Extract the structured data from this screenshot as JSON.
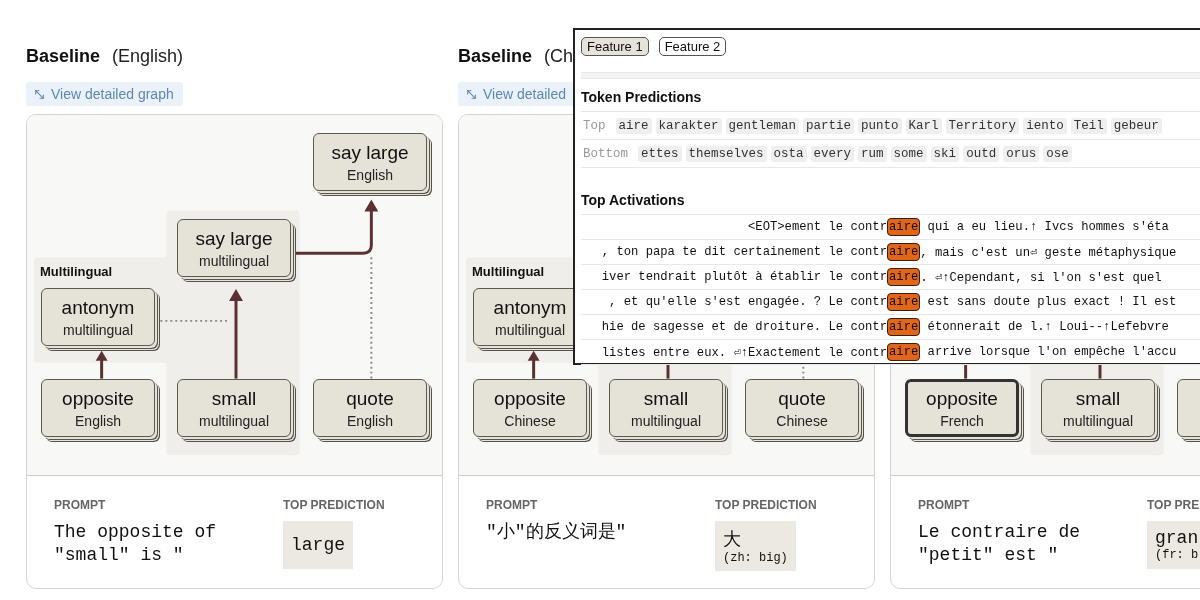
{
  "panels": [
    {
      "title": "Baseline",
      "subtitle": "(English)",
      "graph_button": "View detailed graph",
      "group_label": "Multilingual",
      "nodes": {
        "say_output": {
          "title": "say large",
          "subtitle": "English",
          "selected": false
        },
        "say_multilingual": {
          "title": "say large",
          "subtitle": "multilingual",
          "selected": false
        },
        "antonym": {
          "title": "antonym",
          "subtitle": "multilingual",
          "selected": false
        },
        "opposite": {
          "title": "opposite",
          "subtitle": "English",
          "selected": false
        },
        "small": {
          "title": "small",
          "subtitle": "multilingual",
          "selected": false
        },
        "quote": {
          "title": "quote",
          "subtitle": "English",
          "selected": false
        }
      },
      "prompt_label": "PROMPT",
      "prompt": "The opposite of \"small\" is \"",
      "prediction_label": "TOP PREDICTION",
      "prediction": "large"
    },
    {
      "title": "Baseline",
      "subtitle": "(Ch",
      "graph_button": "View detailed",
      "group_label": "Multilingual",
      "nodes": {
        "antonym": {
          "title": "antonym",
          "subtitle": "multilingual",
          "selected": false
        },
        "opposite": {
          "title": "opposite",
          "subtitle": "Chinese",
          "selected": false
        },
        "small": {
          "title": "small",
          "subtitle": "multilingual",
          "selected": false
        },
        "quote": {
          "title": "quote",
          "subtitle": "Chinese",
          "selected": false
        }
      },
      "prompt_label": "PROMPT",
      "prompt": "\"小\"的反义词是\"",
      "prediction_label": "TOP PREDICTION",
      "prediction": "大",
      "prediction_gloss": "(zh: big)"
    },
    {
      "nodes": {
        "opposite": {
          "title": "opposite",
          "subtitle": "French",
          "selected": true
        },
        "small": {
          "title": "small",
          "subtitle": "multilingual",
          "selected": false
        },
        "quote": {
          "selected": false
        }
      },
      "prompt_label": "PROMPT",
      "prompt": "Le contraire de \"petit\" est \"",
      "prediction_label": "TOP PRE",
      "prediction": "gran",
      "prediction_gloss": "(fr: b"
    }
  ],
  "popup": {
    "tabs": [
      {
        "label": "Feature 1",
        "selected": true
      },
      {
        "label": "Feature 2",
        "selected": false
      }
    ],
    "token_predictions": {
      "heading": "Token Predictions",
      "rows": [
        {
          "label": "Top",
          "tokens": [
            "aire",
            "karakter",
            "gentleman",
            "partie",
            "punto",
            "Karl",
            "Territory",
            "iento",
            "Teil",
            "gebeur"
          ]
        },
        {
          "label": "Bottom",
          "tokens": [
            "ettes",
            "themselves",
            "osta",
            "every",
            "rum",
            "some",
            "ski",
            "outd",
            "orus",
            "ose"
          ]
        }
      ]
    },
    "top_activations": {
      "heading": "Top Activations",
      "rows": [
        {
          "before": "<EOT>ement le contr",
          "token": "aire",
          "after": " qui a eu lieu.↑ Ivcs hommes s'éta"
        },
        {
          "before": ", ton papa te dit certainement le contr",
          "token": "aire",
          "after": ", mais c'est un⏎ geste métaphysique"
        },
        {
          "before": "iver tendrait plutôt à établir le contr",
          "token": "aire",
          "after": ". ⏎↑Cependant, si l'on s'est quel"
        },
        {
          "before": ", et qu'elle s'est engagée. ? Le contr",
          "token": "aire",
          "after": " est sans doute plus exact ! Il est"
        },
        {
          "before": "hie de sagesse et de droiture. Le contr",
          "token": "aire",
          "after": " étonnerait de l.↑ Loui--↑Lefebvre"
        },
        {
          "before": "listes entre eux. ⏎↑Exactement le contr",
          "token": "aire",
          "after": " arrive lorsque l'on empêche l'accu"
        }
      ]
    }
  }
}
